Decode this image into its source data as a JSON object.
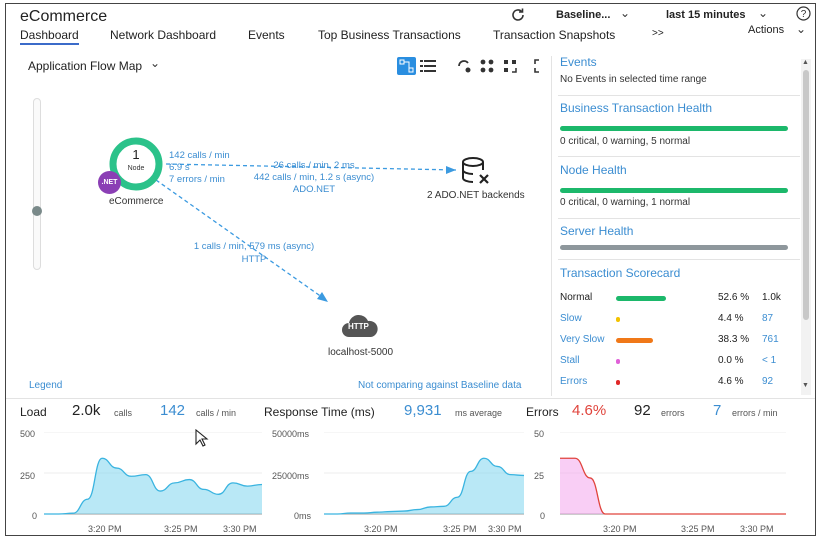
{
  "header": {
    "app_title": "eCommerce",
    "tabs": [
      "Dashboard",
      "Network Dashboard",
      "Events",
      "Top Business Transactions",
      "Transaction Snapshots"
    ],
    "more": ">>",
    "baseline_select": "Baseline...",
    "time_range": "last 15 minutes",
    "actions": "Actions"
  },
  "flow_map": {
    "title": "Application Flow Map",
    "legend": "Legend",
    "baseline_note": "Not comparing against Baseline data",
    "node": {
      "count": "1",
      "sub": "Node",
      "badge": ".NET",
      "name": "eCommerce"
    },
    "node_stats": [
      "142 calls / min",
      "6.9 s",
      "7 errors / min"
    ],
    "backend_edge": [
      "26 calls / min, 2 ms",
      "442 calls / min, 1.2 s (async)",
      "ADO.NET"
    ],
    "backend_name": "2 ADO.NET backends",
    "http_edge": [
      "1 calls / min, 579 ms (async)",
      "HTTP"
    ],
    "http_node": {
      "icon_label": "HTTP",
      "name": "localhost-5000"
    }
  },
  "side_panel": {
    "events": {
      "title": "Events",
      "text": "No Events in selected time range"
    },
    "bt_health": {
      "title": "Business Transaction Health",
      "text": "0 critical, 0 warning, 5 normal"
    },
    "node_health": {
      "title": "Node Health",
      "text": "0 critical, 0 warning, 1 normal"
    },
    "server_health": {
      "title": "Server Health"
    },
    "scorecard": {
      "title": "Transaction Scorecard",
      "rows": [
        {
          "label": "Normal",
          "pct": "52.6 %",
          "count": "1.0k",
          "color": "#1cb86b",
          "fill": 0.526,
          "dark": true
        },
        {
          "label": "Slow",
          "pct": "4.4 %",
          "count": "87",
          "color": "#f2c200",
          "fill": 0.044,
          "dark": false
        },
        {
          "label": "Very Slow",
          "pct": "38.3 %",
          "count": "761",
          "color": "#f07818",
          "fill": 0.383,
          "dark": false
        },
        {
          "label": "Stall",
          "pct": "0.0 %",
          "count": "< 1",
          "color": "#e060d8",
          "fill": 0.0,
          "dark": false
        },
        {
          "label": "Errors",
          "pct": "4.6 %",
          "count": "92",
          "color": "#e02828",
          "fill": 0.046,
          "dark": false
        }
      ]
    }
  },
  "stats": {
    "load": {
      "label": "Load",
      "calls": "2.0k",
      "calls_unit": "calls",
      "rate": "142",
      "rate_unit": "calls / min"
    },
    "response": {
      "label": "Response Time (ms)",
      "value": "9,931",
      "unit": "ms average"
    },
    "errors": {
      "label": "Errors",
      "pct": "4.6%",
      "count": "92",
      "count_unit": "errors",
      "rate": "7",
      "rate_unit": "errors / min"
    }
  },
  "charts": [
    {
      "ymax": "500",
      "ymid": "250",
      "ymin": "0",
      "xticks": [
        "3:20 PM",
        "3:25 PM",
        "3:30 PM"
      ]
    },
    {
      "ymax": "50000ms",
      "ymid": "25000ms",
      "ymin": "0ms",
      "xticks": [
        "3:20 PM",
        "3:25 PM",
        "3:30 PM"
      ]
    },
    {
      "ymax": "50",
      "ymid": "25",
      "ymin": "0",
      "xticks": [
        "3:20 PM",
        "3:25 PM",
        "3:30 PM"
      ]
    }
  ],
  "chart_data": [
    {
      "type": "area",
      "ylim": [
        0,
        500
      ],
      "x": [
        "3:16",
        "3:17",
        "3:18",
        "3:19",
        "3:20",
        "3:21",
        "3:22",
        "3:23",
        "3:24",
        "3:25",
        "3:26",
        "3:27",
        "3:28",
        "3:29",
        "3:30",
        "3:31"
      ],
      "values": [
        0,
        0,
        5,
        90,
        340,
        280,
        230,
        240,
        140,
        190,
        210,
        150,
        120,
        190,
        170,
        180
      ],
      "color": "#7fd6ef"
    },
    {
      "type": "area",
      "ylim": [
        0,
        50000
      ],
      "x": [
        "3:16",
        "3:17",
        "3:18",
        "3:19",
        "3:20",
        "3:21",
        "3:22",
        "3:23",
        "3:24",
        "3:25",
        "3:26",
        "3:27",
        "3:28",
        "3:29",
        "3:30",
        "3:31"
      ],
      "values": [
        0,
        0,
        600,
        600,
        1100,
        1500,
        1800,
        2700,
        4300,
        4700,
        10200,
        26000,
        34000,
        29000,
        24000,
        23500
      ],
      "color": "#7fd6ef"
    },
    {
      "type": "area",
      "ylim": [
        0,
        50
      ],
      "x": [
        "3:16",
        "3:17",
        "3:18",
        "3:19",
        "3:20",
        "3:21",
        "3:22",
        "3:23",
        "3:24",
        "3:25",
        "3:26",
        "3:27",
        "3:28",
        "3:29",
        "3:30",
        "3:31"
      ],
      "values": [
        34,
        34,
        22,
        0,
        0,
        0,
        0,
        0,
        0,
        0,
        0,
        0,
        0,
        0,
        0,
        0
      ],
      "color": "#f4a6ec"
    }
  ]
}
